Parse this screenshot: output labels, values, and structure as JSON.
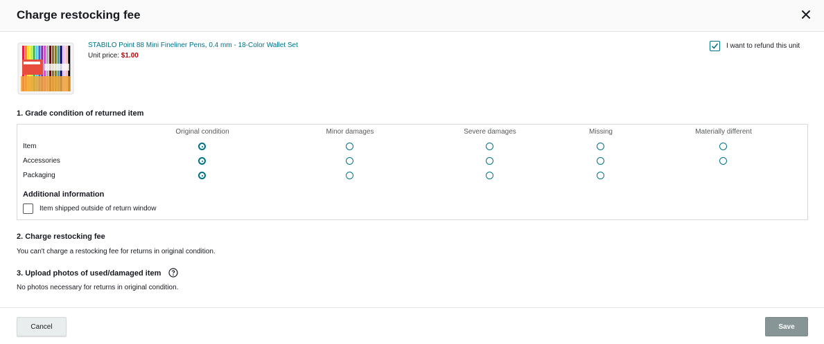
{
  "modal": {
    "title": "Charge restocking fee",
    "close_icon": "close-icon"
  },
  "product": {
    "name": "STABILO Point 88 Mini Fineliner Pens, 0.4 mm - 18-Color Wallet Set",
    "unit_price_label": "Unit price:",
    "unit_price_value": "$1.00",
    "refund_label": "I want to refund this unit",
    "refund_checked": true
  },
  "grade": {
    "section_title": "1. Grade condition of returned item",
    "columns": [
      "Original condition",
      "Minor damages",
      "Severe damages",
      "Missing",
      "Materially different"
    ],
    "rows": [
      {
        "label": "Item",
        "selected": "Original condition"
      },
      {
        "label": "Accessories",
        "selected": "Original condition"
      },
      {
        "label": "Packaging",
        "selected": "Original condition"
      }
    ],
    "additional_title": "Additional information",
    "outside_window_label": "Item shipped outside of return window",
    "outside_window_checked": false
  },
  "restocking": {
    "section_title": "2. Charge restocking fee",
    "text": "You can't charge a restocking fee for returns in original condition."
  },
  "photos": {
    "section_title": "3. Upload photos of used/damaged item",
    "help_icon": "help-circle-icon",
    "text": "No photos necessary for returns in original condition."
  },
  "footer": {
    "cancel_label": "Cancel",
    "save_label": "Save"
  },
  "colors": {
    "accent": "#007185",
    "price": "#c40000",
    "save_button_disabled": "#879596"
  }
}
